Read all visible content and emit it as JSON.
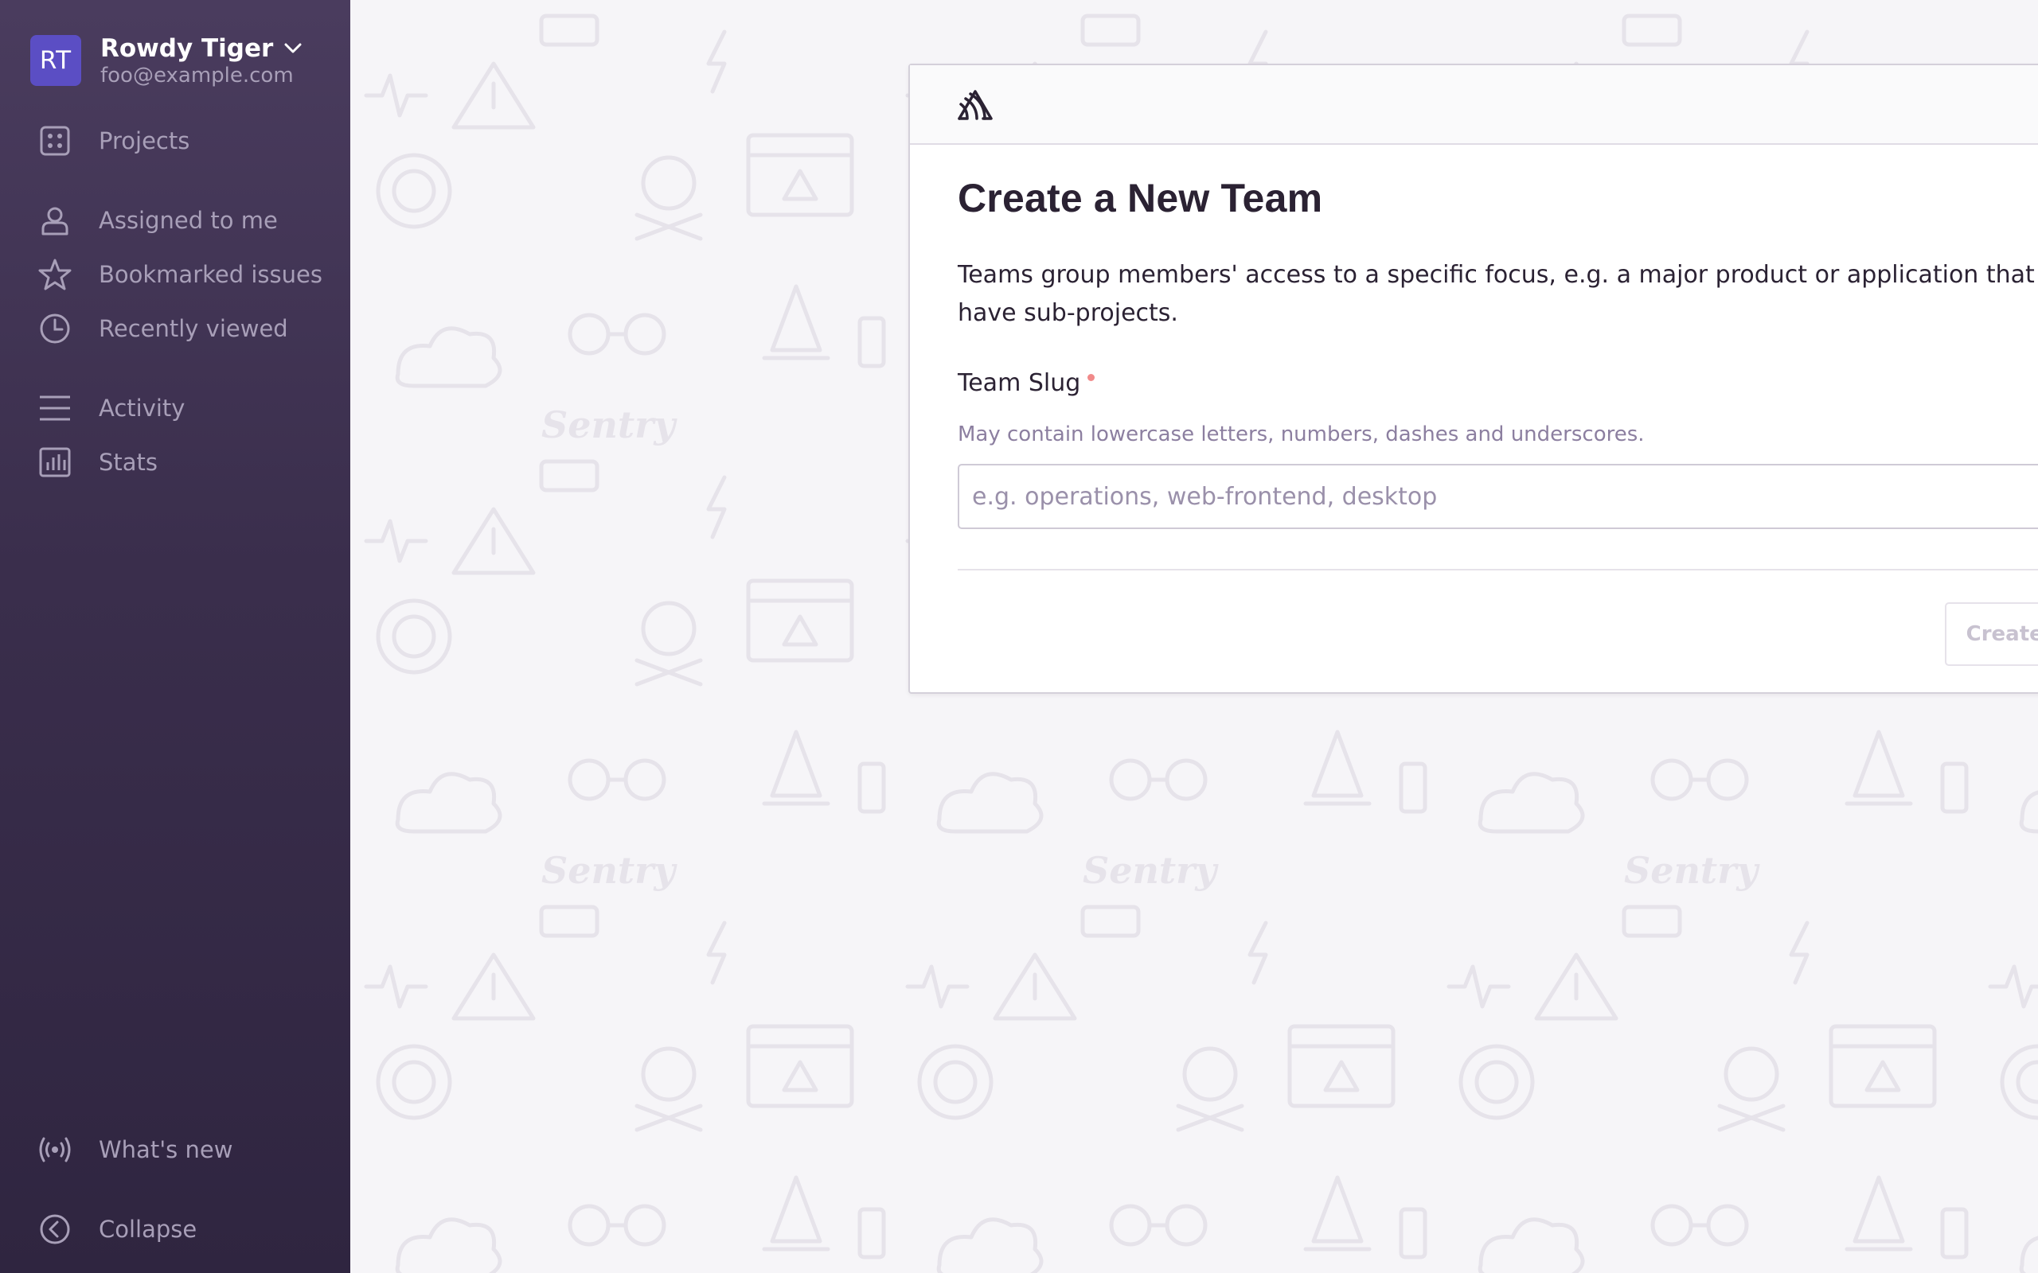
{
  "sidebar": {
    "org": {
      "initials": "RT",
      "name": "Rowdy Tiger",
      "email": "foo@example.com",
      "avatar_color": "#5b4ec4"
    },
    "items": [
      {
        "label": "Projects",
        "icon": "projects-grid-icon"
      },
      {
        "label": "Assigned to me",
        "icon": "user-icon"
      },
      {
        "label": "Bookmarked issues",
        "icon": "star-icon"
      },
      {
        "label": "Recently viewed",
        "icon": "clock-icon"
      },
      {
        "label": "Activity",
        "icon": "activity-lines-icon"
      },
      {
        "label": "Stats",
        "icon": "stats-bar-icon"
      }
    ],
    "footer": [
      {
        "label": "What's new",
        "icon": "broadcast-icon"
      },
      {
        "label": "Collapse",
        "icon": "collapse-chevron-icon"
      }
    ]
  },
  "card": {
    "logo": "sentry-logo-icon",
    "title": "Create a New Team",
    "description": "Teams group members' access to a specific focus, e.g. a major product or application that may have sub-projects.",
    "field": {
      "label": "Team Slug",
      "required": true,
      "help": "May contain lowercase letters, numbers, dashes and underscores.",
      "placeholder": "e.g. operations, web-frontend, desktop",
      "value": ""
    },
    "submit_label": "Create Team"
  },
  "colors": {
    "sidebar_top": "#4a3c5e",
    "sidebar_bottom": "#2f2540",
    "required_dot": "#f18a8a",
    "background": "#f6f5f8"
  }
}
